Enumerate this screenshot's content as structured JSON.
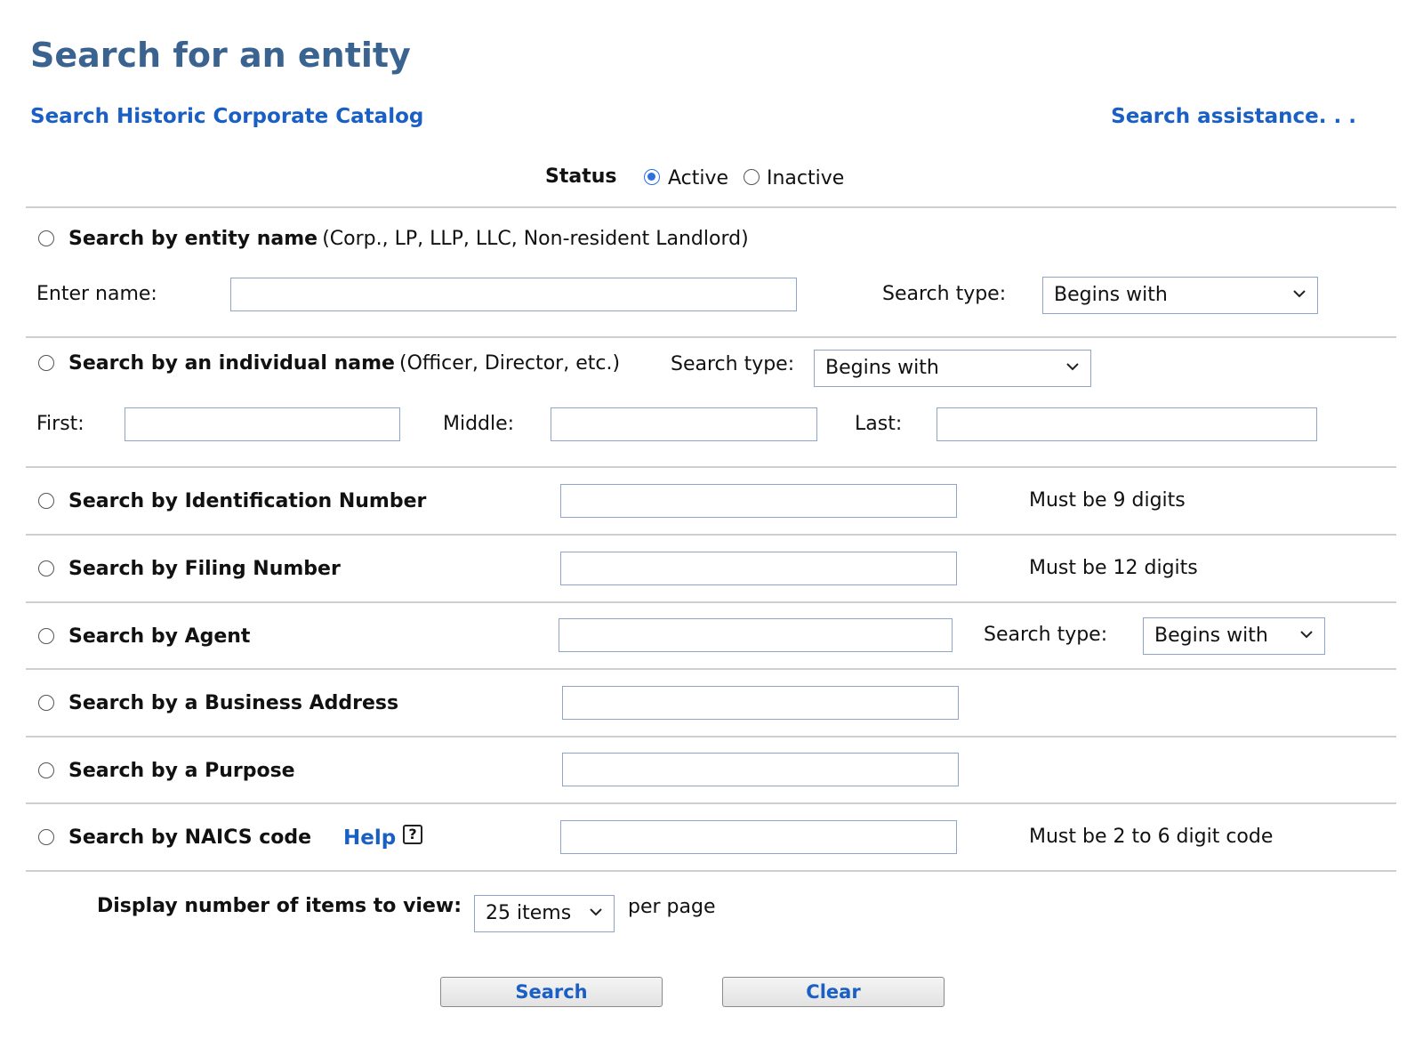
{
  "page_title": "Search for an entity",
  "links": {
    "historic": "Search Historic Corporate Catalog",
    "assistance": "Search assistance. . ."
  },
  "status": {
    "label": "Status",
    "active": "Active",
    "inactive": "Inactive",
    "selected": "Active"
  },
  "entity_name": {
    "label": "Search by entity name",
    "note": "(Corp., LP, LLP, LLC, Non-resident Landlord)",
    "input_label": "Enter name:",
    "search_type_label": "Search type:",
    "search_type_value": "Begins with"
  },
  "individual": {
    "label": "Search by an individual name",
    "note": "(Officer, Director, etc.)",
    "search_type_label": "Search type:",
    "search_type_value": "Begins with",
    "first_label": "First:",
    "middle_label": "Middle:",
    "last_label": "Last:"
  },
  "id_number": {
    "label": "Search by Identification Number",
    "hint": "Must be 9 digits"
  },
  "filing_number": {
    "label": "Search by Filing Number",
    "hint": "Must be 12 digits"
  },
  "agent": {
    "label": "Search by Agent",
    "search_type_label": "Search type:",
    "search_type_value": "Begins with"
  },
  "business_address": {
    "label": "Search by a Business Address"
  },
  "purpose": {
    "label": "Search by a Purpose"
  },
  "naics": {
    "label": "Search by NAICS code",
    "help": "Help",
    "help_icon": "?",
    "hint": "Must be 2 to 6 digit code"
  },
  "display": {
    "label": "Display number of items to view:",
    "value": "25 items",
    "suffix": "per page"
  },
  "buttons": {
    "search": "Search",
    "clear": "Clear"
  }
}
